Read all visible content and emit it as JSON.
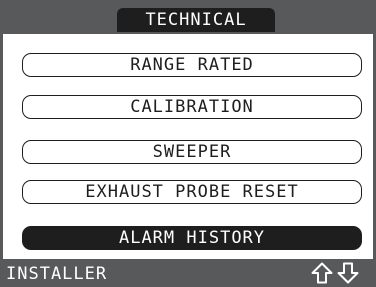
{
  "header": {
    "title": "TECHNICAL"
  },
  "menu": {
    "items": [
      {
        "label": "RANGE RATED"
      },
      {
        "label": "CALIBRATION"
      },
      {
        "label": "SWEEPER"
      },
      {
        "label": "EXHAUST PROBE RESET"
      },
      {
        "label": "ALARM HISTORY",
        "selected": true
      }
    ]
  },
  "footer": {
    "mode_label": "INSTALLER",
    "icons": [
      "arrow-up-icon",
      "arrow-down-icon"
    ]
  },
  "colors": {
    "bezel_gray": "#58595b",
    "selected_bg": "#1e1e1e",
    "text_dark": "#1e1e1e",
    "background": "#ffffff"
  }
}
